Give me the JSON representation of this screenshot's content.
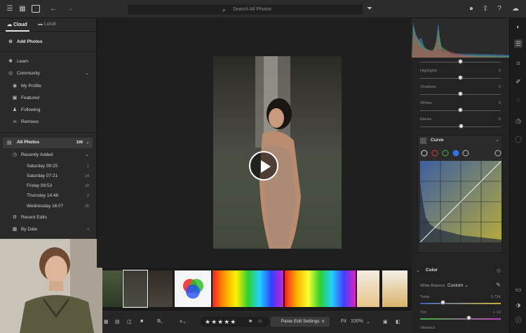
{
  "topbar": {
    "search_placeholder": "Search All Photos"
  },
  "sidebar": {
    "tabs": [
      {
        "label": "Cloud"
      },
      {
        "label": "Local"
      }
    ],
    "add_photos": "Add Photos",
    "learn": "Learn",
    "community": "Community",
    "community_items": [
      {
        "label": "My Profile"
      },
      {
        "label": "Featured"
      },
      {
        "label": "Following"
      },
      {
        "label": "Remixes"
      }
    ],
    "all_photos": {
      "label": "All Photos",
      "count": "109"
    },
    "recently_added": "Recently Added",
    "dates": [
      {
        "label": "Saturday  09:25",
        "count": "1"
      },
      {
        "label": "Saturday  07:21",
        "count": "14"
      },
      {
        "label": "Friday  09:53",
        "count": "10"
      },
      {
        "label": "Thursday  14:48",
        "count": "2"
      },
      {
        "label": "Wednesday  16:07",
        "count": "26"
      }
    ],
    "recent_edits": "Recent Edits",
    "by_date": "By Date"
  },
  "bottombar": {
    "paste_label": "Paste Edit Settings",
    "zoom_fit": "Fit",
    "zoom_value": "100%",
    "stars": "★★★★★"
  },
  "rightpanel": {
    "sliders": [
      {
        "label": "Highlights",
        "value": "0",
        "pos": 0.5
      },
      {
        "label": "Shadows",
        "value": "0",
        "pos": 0.5
      },
      {
        "label": "Whites",
        "value": "0",
        "pos": 0.5
      },
      {
        "label": "Blacks",
        "value": "0",
        "pos": 0.5
      }
    ],
    "curve_title": "Curve",
    "color_title": "Color",
    "white_balance_label": "White Balance",
    "white_balance_value": "Custom",
    "temp_label": "Temp",
    "temp_value": "5.71K",
    "temp_pos": 0.28,
    "tint_label": "Tint",
    "tint_value": "+ 16",
    "tint_pos": 0.6,
    "vibrance_label": "Vibrance"
  },
  "colors": {
    "accent": "#2f76e6",
    "background": "#1d1d1d"
  }
}
